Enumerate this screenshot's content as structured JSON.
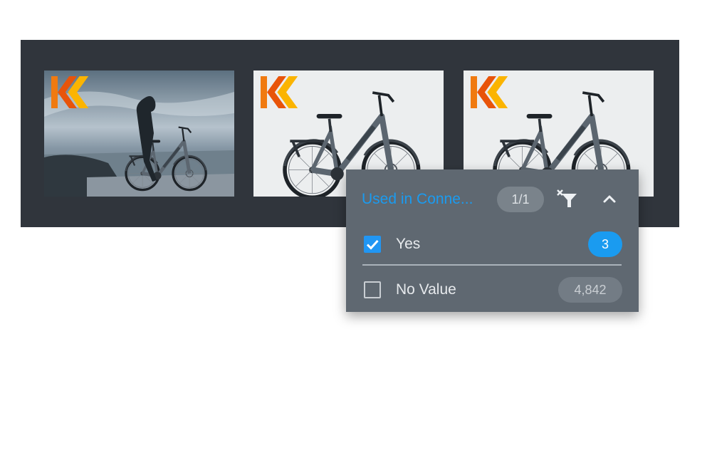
{
  "gallery": {
    "thumbnails": [
      {
        "subject": "woman with e-bike photo",
        "logo": "orange-chevron-logo"
      },
      {
        "subject": "e-bike product photo",
        "logo": "orange-chevron-logo"
      },
      {
        "subject": "e-bike product photo",
        "logo": "orange-chevron-logo"
      }
    ]
  },
  "filter_panel": {
    "title": "Used in Conne...",
    "selection_count": "1/1",
    "clear_filter_icon": "clear-filter-icon",
    "collapse_icon": "chevron-up-icon",
    "options": [
      {
        "label": "Yes",
        "count": "3",
        "checked": true
      },
      {
        "label": "No Value",
        "count": "4,842",
        "checked": false
      }
    ],
    "accent_color": "#1a9bf0"
  }
}
